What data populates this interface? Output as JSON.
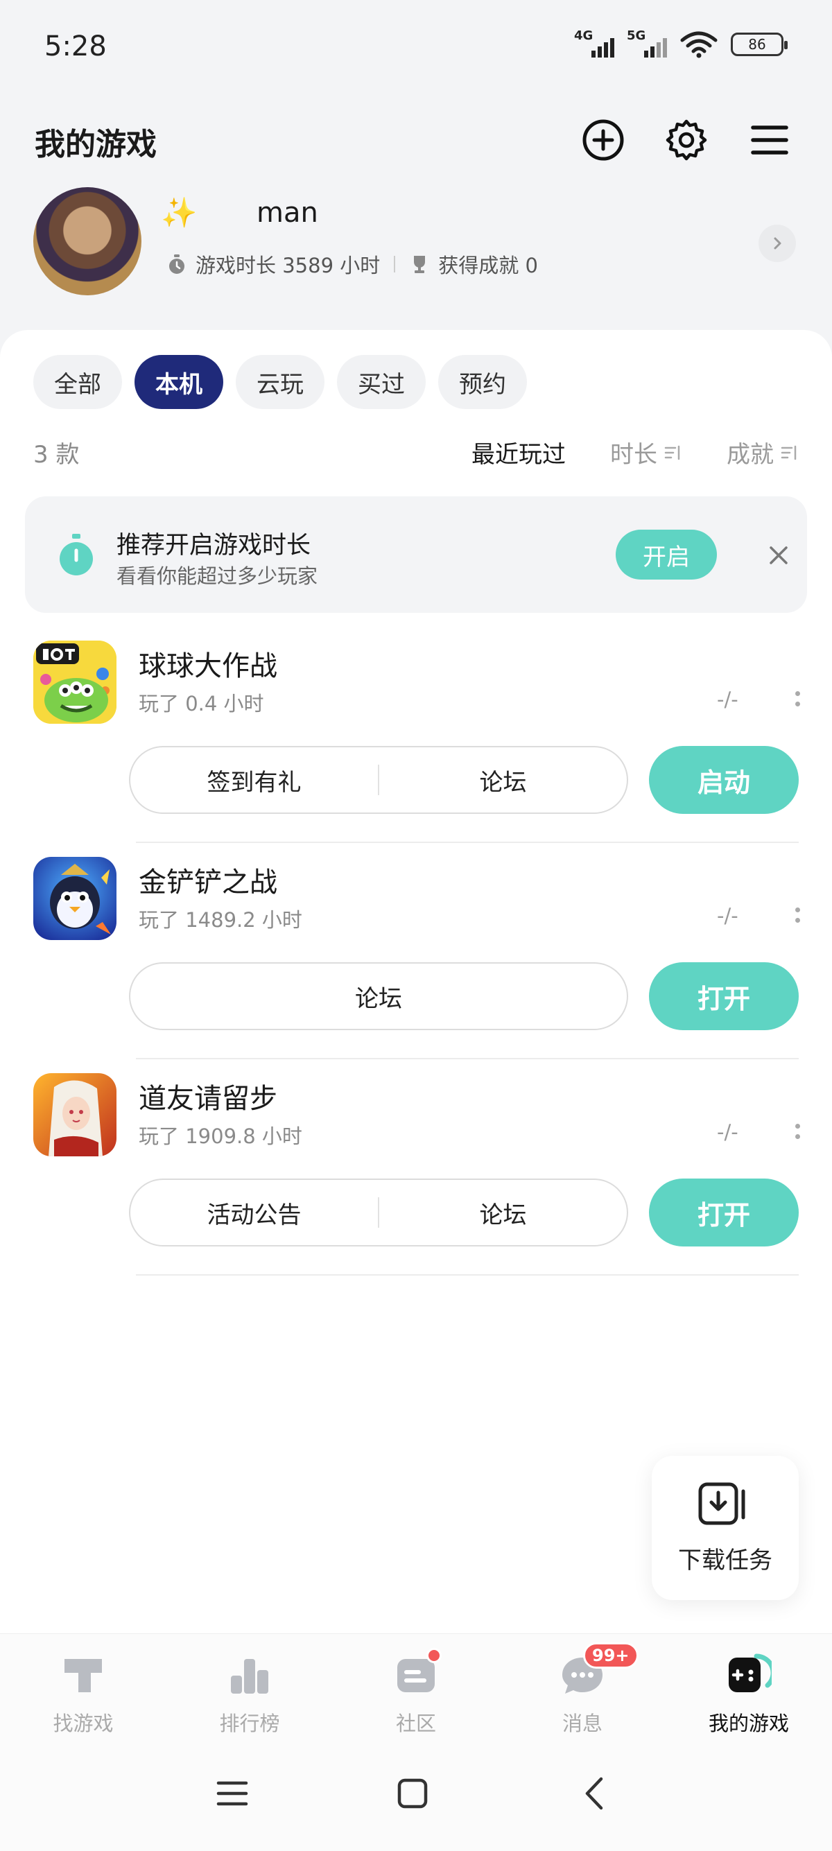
{
  "status": {
    "time": "5:28",
    "sig1": "4G",
    "sig2": "5G",
    "battery": "86"
  },
  "header": {
    "title": "我的游戏"
  },
  "profile": {
    "username": "man",
    "playtime": "游戏时长 3589 小时",
    "achievements": "获得成就 0"
  },
  "filters": [
    {
      "label": "全部",
      "active": false
    },
    {
      "label": "本机",
      "active": true
    },
    {
      "label": "云玩",
      "active": false
    },
    {
      "label": "买过",
      "active": false
    },
    {
      "label": "预约",
      "active": false
    }
  ],
  "list": {
    "count": "3 款",
    "sorts": [
      "最近玩过",
      "时长",
      "成就"
    ]
  },
  "banner": {
    "title": "推荐开启游戏时长",
    "subtitle": "看看你能超过多少玩家",
    "button": "开启"
  },
  "games": [
    {
      "name": "球球大作战",
      "played": "玩了 0.4 小时",
      "status": "-/-",
      "actions": [
        "签到有礼",
        "论坛"
      ],
      "launch": "启动"
    },
    {
      "name": "金铲铲之战",
      "played": "玩了 1489.2 小时",
      "status": "-/-",
      "actions": [
        "论坛"
      ],
      "launch": "打开"
    },
    {
      "name": "道友请留步",
      "played": "玩了 1909.8 小时",
      "status": "-/-",
      "actions": [
        "活动公告",
        "论坛"
      ],
      "launch": "打开"
    }
  ],
  "fab": {
    "label": "下载任务"
  },
  "nav": [
    {
      "label": "找游戏",
      "icon": "find-game-icon"
    },
    {
      "label": "排行榜",
      "icon": "ranking-icon"
    },
    {
      "label": "社区",
      "icon": "community-icon"
    },
    {
      "label": "消息",
      "icon": "message-icon",
      "badge": "99+"
    },
    {
      "label": "我的游戏",
      "icon": "my-games-icon",
      "active": true
    }
  ],
  "colors": {
    "accent": "#5fd4c3",
    "chip_active": "#1f2a7a",
    "badge": "#f25757"
  }
}
